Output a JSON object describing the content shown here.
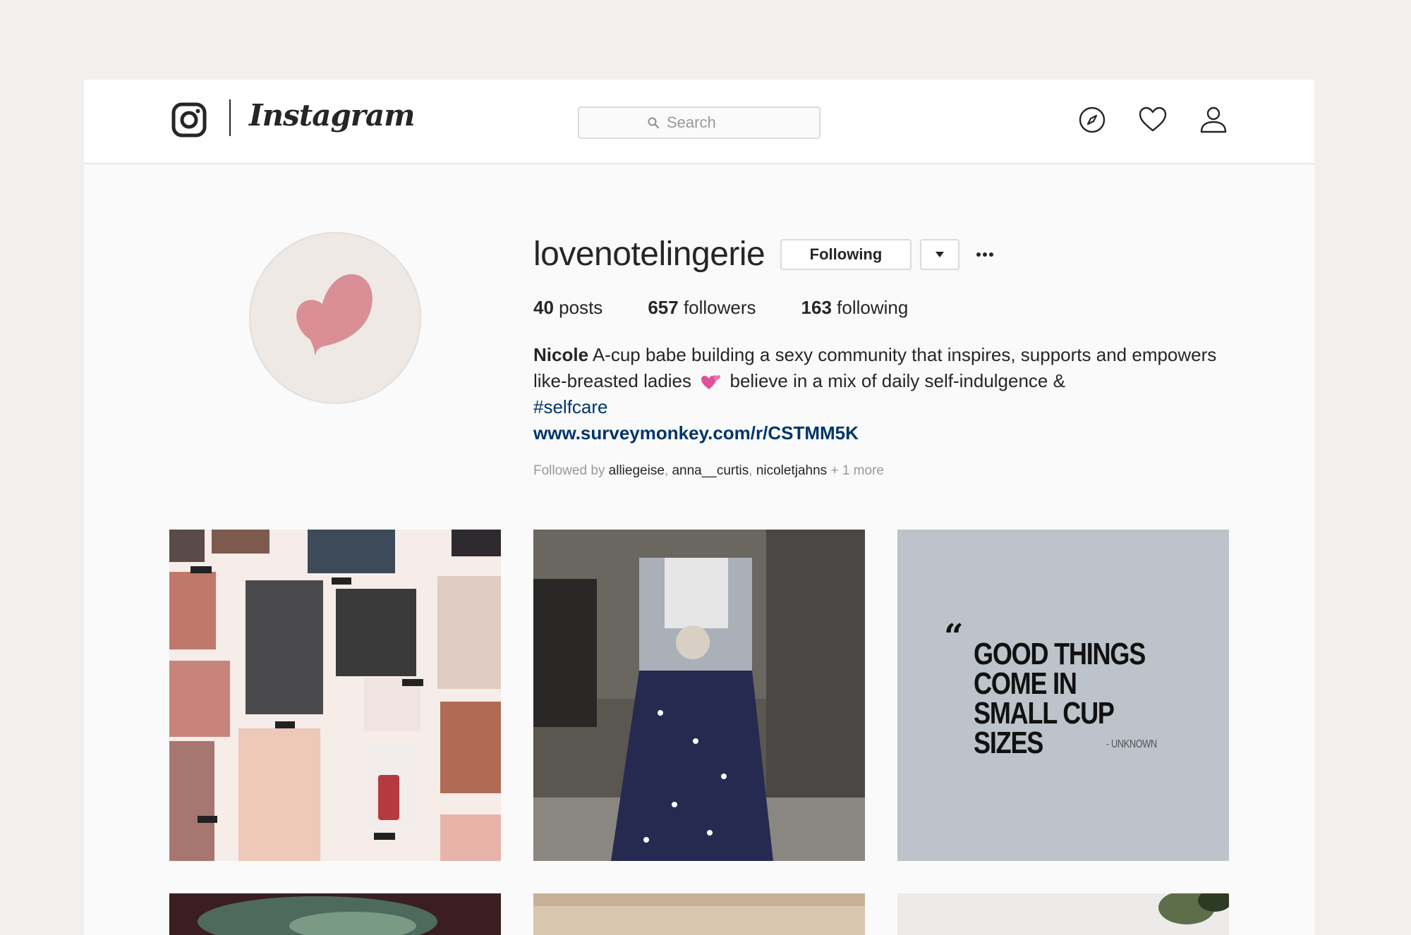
{
  "nav": {
    "wordmark": "Instagram",
    "search_placeholder": "Search",
    "icons": [
      "instagram-glyph-icon",
      "compass-icon",
      "heart-icon",
      "profile-icon"
    ]
  },
  "profile": {
    "username": "lovenotelingerie",
    "following_label": "Following",
    "stats": {
      "posts_count": "40",
      "posts_label": "posts",
      "followers_count": "657",
      "followers_label": "followers",
      "following_count": "163",
      "following_label": "following"
    },
    "bio": {
      "name": "Nicole",
      "text_1": "A-cup babe building a sexy community that inspires, supports and empowers like-breasted ladies",
      "text_2": "believe in a mix of daily self-indulgence &",
      "hashtag": "#selfcare",
      "link": "www.surveymonkey.com/r/CSTMM5K"
    },
    "followed_by": {
      "prefix": "Followed by",
      "users": [
        "alliegeise",
        "anna__curtis",
        "nicoletjahns"
      ],
      "suffix": "+ 1 more"
    }
  },
  "posts": {
    "quote": {
      "text": "GOOD THINGS\nCOME IN\nSMALL CUP SIZES",
      "attribution": "- UNKNOWN"
    }
  },
  "colors": {
    "page_bg": "#f4efef",
    "link": "#003569",
    "avatar_heart": "#d98f95",
    "quote_bg": "#bcc3ca"
  }
}
